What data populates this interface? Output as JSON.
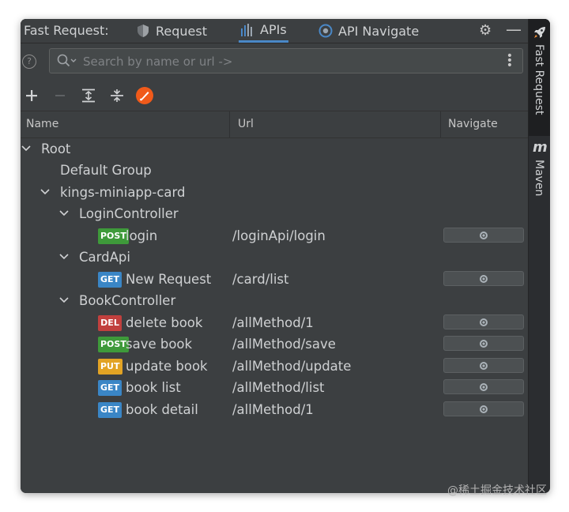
{
  "panel": {
    "title": "Fast Request:"
  },
  "tabs": [
    {
      "label": "Request",
      "icon": "shield-icon"
    },
    {
      "label": "APIs",
      "icon": "bars-icon"
    },
    {
      "label": "API Navigate",
      "icon": "target-icon"
    }
  ],
  "header_icons": {
    "settings": "gear-icon",
    "minimize": "minus-icon"
  },
  "search": {
    "help": "?",
    "placeholder": "Search by name or url ->"
  },
  "columns": {
    "name": "Name",
    "url": "Url",
    "navigate": "Navigate"
  },
  "tree": {
    "root": "Root",
    "default_group": "Default Group",
    "module": "kings-miniapp-card",
    "login_controller": {
      "name": "LoginController",
      "items": [
        {
          "method": "POST",
          "name": "login",
          "url": "/loginApi/login"
        }
      ]
    },
    "card_api": {
      "name": "CardApi",
      "items": [
        {
          "method": "GET",
          "name": "New Request",
          "url": "/card/list"
        }
      ]
    },
    "book_controller": {
      "name": "BookController",
      "items": [
        {
          "method": "DEL",
          "name": "delete book",
          "url": "/allMethod/1"
        },
        {
          "method": "POST",
          "name": "save book",
          "url": "/allMethod/save"
        },
        {
          "method": "PUT",
          "name": "update book",
          "url": "/allMethod/update"
        },
        {
          "method": "GET",
          "name": "book list",
          "url": "/allMethod/list"
        },
        {
          "method": "GET",
          "name": "book detail",
          "url": "/allMethod/1"
        }
      ]
    }
  },
  "sidebar": {
    "fast_request": "Fast Request",
    "maven_glyph": "m",
    "maven": "Maven"
  },
  "watermark": "@稀土掘金技术社区",
  "colors": {
    "accent": "#4a88c7",
    "post": "#3e9a3a",
    "get": "#3a86c6",
    "del": "#c1403e",
    "put": "#e2a324"
  }
}
